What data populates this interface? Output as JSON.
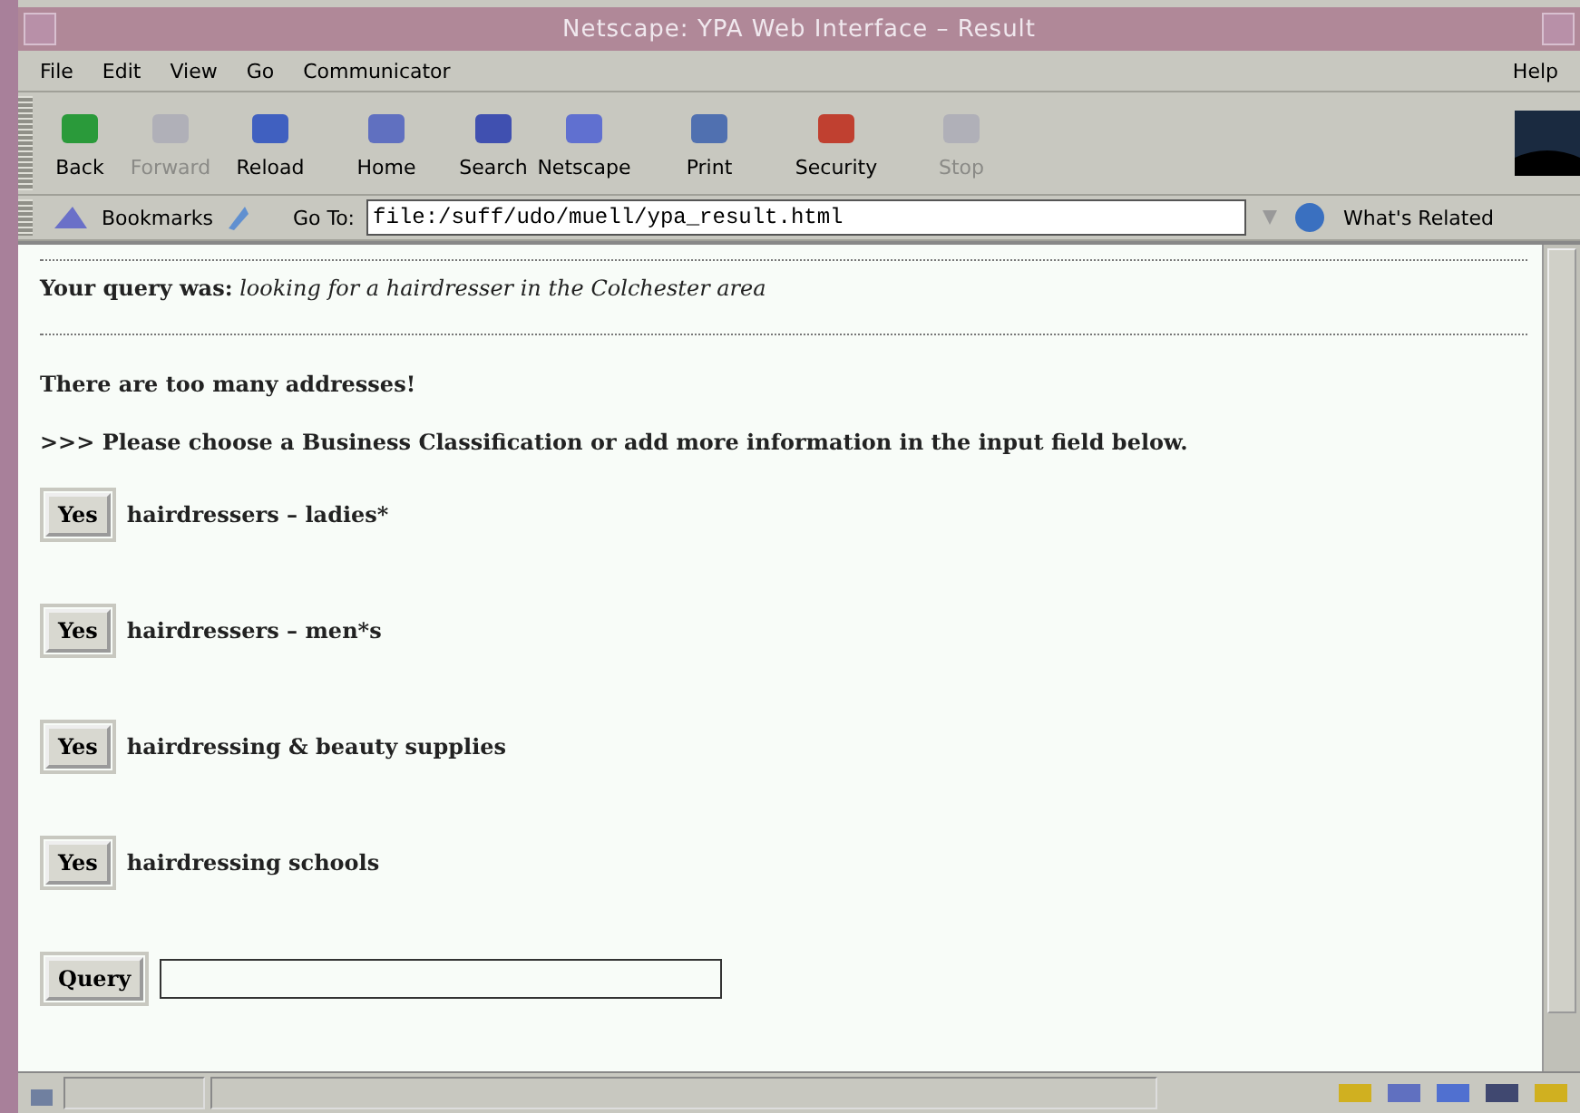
{
  "window": {
    "title": "Netscape: YPA Web Interface – Result"
  },
  "menu": [
    "File",
    "Edit",
    "View",
    "Go",
    "Communicator"
  ],
  "menu_right": "Help",
  "toolbar": [
    {
      "label": "Back",
      "disabled": false
    },
    {
      "label": "Forward",
      "disabled": true
    },
    {
      "label": "Reload",
      "disabled": false
    },
    {
      "label": "Home",
      "disabled": false
    },
    {
      "label": "Search",
      "disabled": false
    },
    {
      "label": "Netscape",
      "disabled": false
    },
    {
      "label": "Print",
      "disabled": false
    },
    {
      "label": "Security",
      "disabled": false
    },
    {
      "label": "Stop",
      "disabled": true
    }
  ],
  "location": {
    "bookmarks": "Bookmarks",
    "goto_label": "Go To:",
    "url": "file:/suff/udo/muell/ypa_result.html",
    "related": "What's Related"
  },
  "page": {
    "query_label": "Your query was:",
    "query": "looking for a hairdresser in the Colchester area",
    "warning": "There are too many addresses!",
    "instruction": ">>> Please choose a Business Classification or add more information in the input field below.",
    "options": [
      {
        "button": "Yes",
        "label": "hairdressers – ladies*"
      },
      {
        "button": "Yes",
        "label": "hairdressers – men*s"
      },
      {
        "button": "Yes",
        "label": "hairdressing & beauty supplies"
      },
      {
        "button": "Yes",
        "label": "hairdressing schools"
      }
    ],
    "query_button": "Query"
  }
}
